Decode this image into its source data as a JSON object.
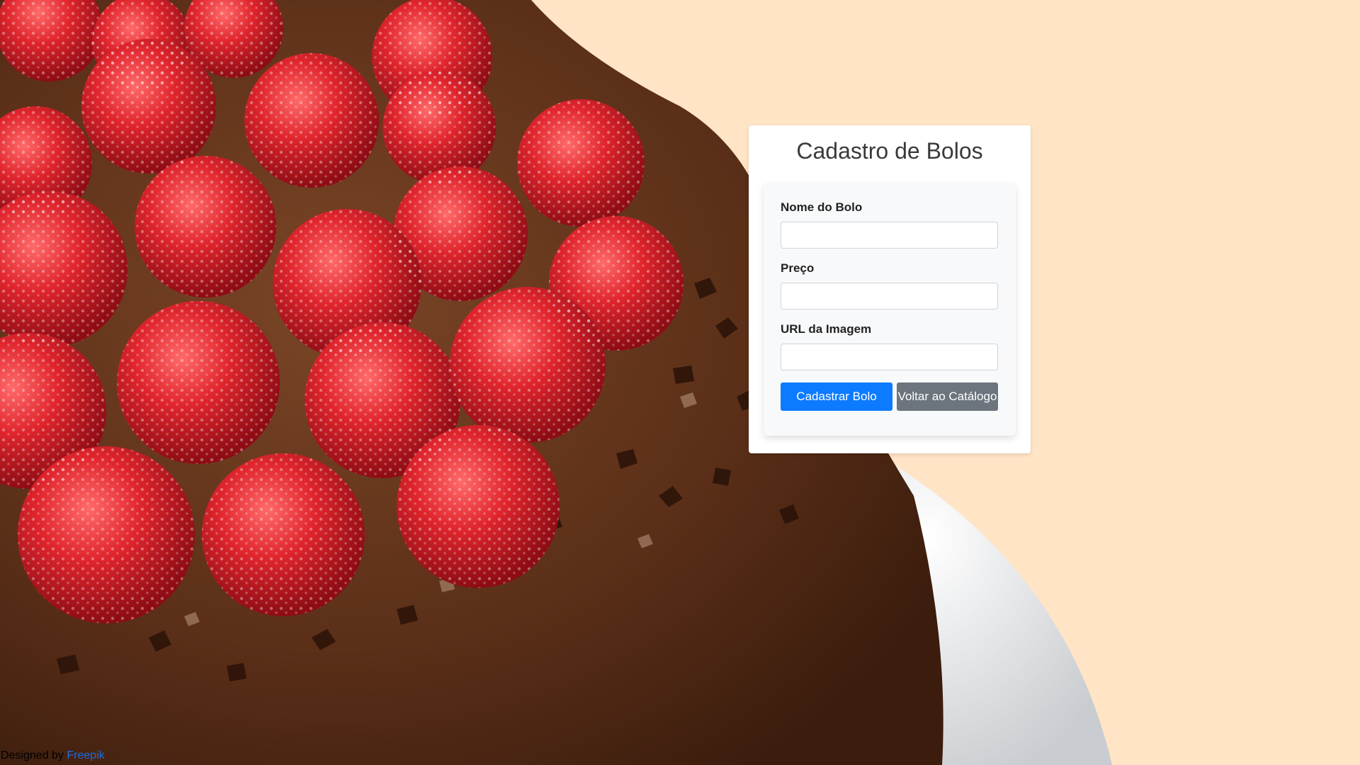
{
  "form": {
    "title": "Cadastro de Bolos",
    "fields": [
      {
        "label": "Nome do Bolo",
        "value": "",
        "placeholder": ""
      },
      {
        "label": "Preço",
        "value": "",
        "placeholder": ""
      },
      {
        "label": "URL da Imagem",
        "value": "",
        "placeholder": ""
      }
    ],
    "submit_label": "Cadastrar Bolo",
    "back_label": "Voltar ao Catálogo"
  },
  "footer": {
    "credit_prefix": "Designed by",
    "credit_link": "Freepik"
  },
  "colors": {
    "page_background": "#ffe4c6",
    "primary_button": "#0d7bff",
    "secondary_button": "#6c757d",
    "link": "#1a6fe0"
  },
  "background_image": "chocolate-cake-with-raspberries-photo"
}
